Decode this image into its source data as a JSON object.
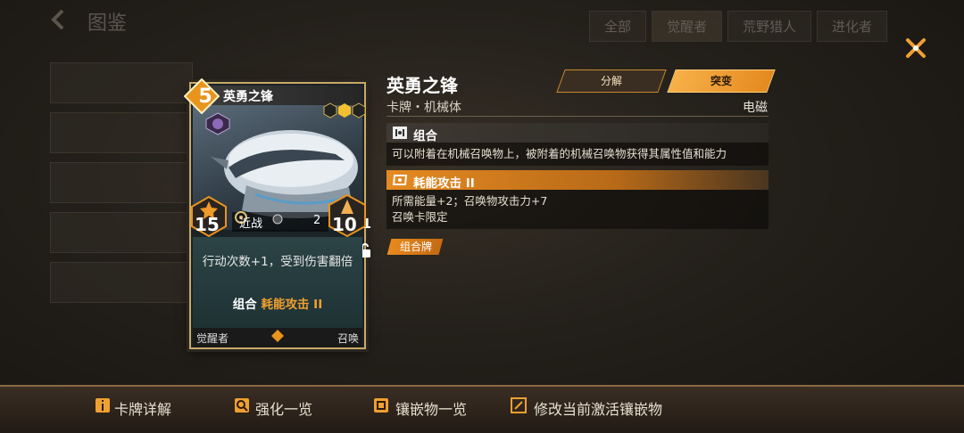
{
  "background": {
    "title": "图鉴",
    "tabs": [
      "全部",
      "觉醒者",
      "荒野猎人",
      "进化者"
    ]
  },
  "card": {
    "cost": "5",
    "name": "英勇之锋",
    "quantity": "x1",
    "attack": "15",
    "health": "10",
    "range": "近战",
    "range_value": "2",
    "description": "行动次数+1，受到伤害翻倍",
    "combo_label": "组合",
    "combo_name": "耗能攻击 II",
    "footer_left": "觉醒者",
    "footer_right": "召唤"
  },
  "detail": {
    "name": "英勇之锋",
    "subtype": "卡牌・机械体",
    "element": "电磁",
    "decompose_label": "分解",
    "breakthrough_label": "突变",
    "sections": [
      {
        "title": "组合",
        "body": "可以附着在机械召唤物上，被附着的机械召唤物获得其属性值和能力"
      },
      {
        "title": "耗能攻击 II",
        "body": "所需能量+2；召唤物攻击力+7",
        "note": "召唤卡限定"
      }
    ],
    "tag": "组合牌"
  },
  "bottom_bar": {
    "items": [
      "卡牌详解",
      "强化一览",
      "镶嵌物一览",
      "修改当前激活镶嵌物"
    ]
  },
  "colors": {
    "accent": "#e88a1e",
    "card_border": "#c8a968"
  }
}
